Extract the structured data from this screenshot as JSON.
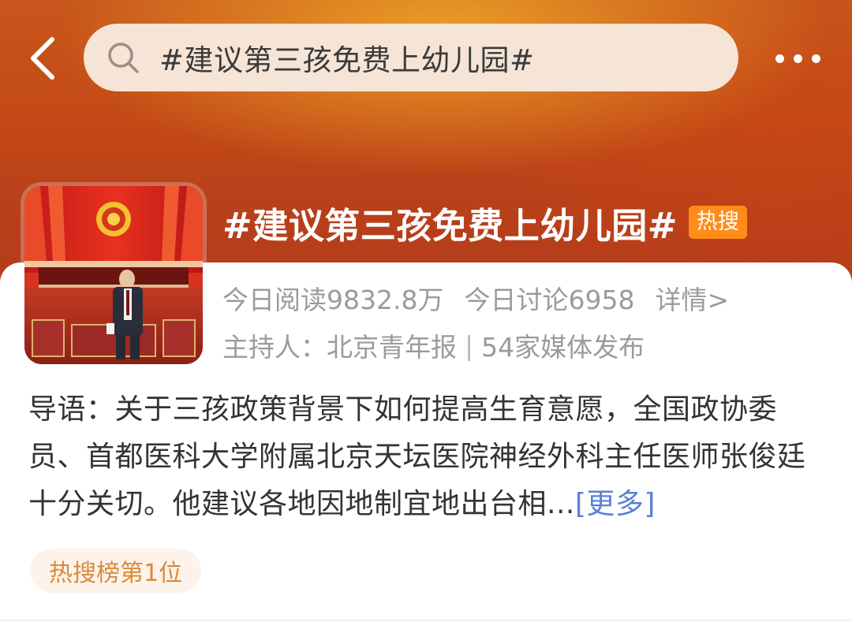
{
  "search": {
    "query": "#建议第三孩免费上幼儿园#"
  },
  "topic": {
    "title": "#建议第三孩免费上幼儿园#",
    "badge": "热搜",
    "reads": "今日阅读9832.8万",
    "discussions": "今日讨论6958",
    "details": "详情>",
    "host": "主持人：北京青年报",
    "separator": "|",
    "media": "54家媒体发布"
  },
  "intro": {
    "text": "导语：关于三孩政策背景下如何提高生育意愿，全国政协委员、首都医科大学附属北京天坛医院神经外科主任医师张俊廷十分关切。他建议各地因地制宜地出台相...",
    "more": "[更多]"
  },
  "rank": {
    "label": "热搜榜第1位"
  },
  "colors": {
    "header": "#c44a17",
    "accent_badge": "#ff8c1a",
    "link": "#5b7fd6",
    "rank_text": "#d98a3a"
  },
  "icons": [
    "back-arrow-icon",
    "search-icon",
    "more-icon"
  ]
}
